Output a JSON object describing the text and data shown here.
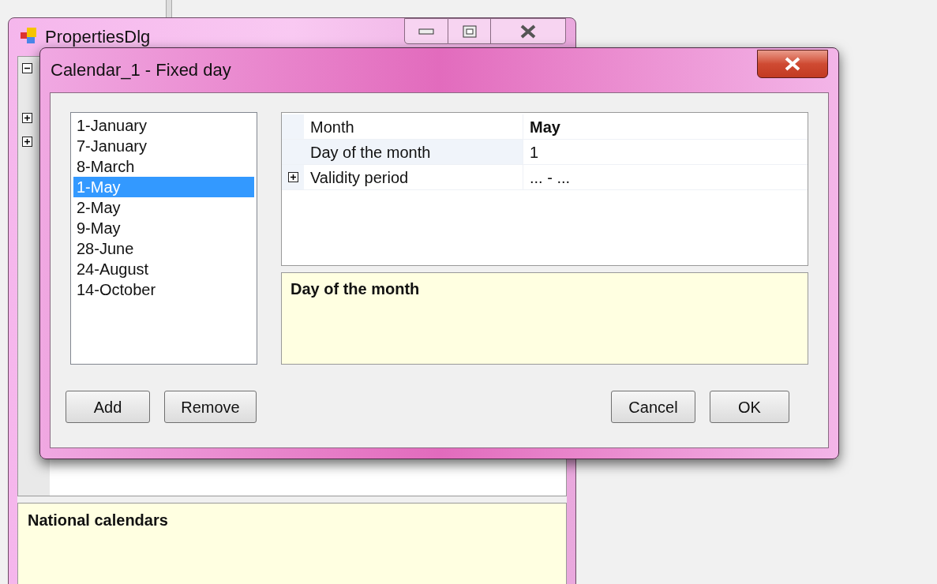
{
  "background_window": {
    "title": "PropertiesDlg",
    "tree": [
      {
        "expanded": true
      },
      {
        "expanded": false
      },
      {
        "expanded": false
      }
    ],
    "description": {
      "title": "National calendars"
    }
  },
  "dialog": {
    "title": "Calendar_1 - Fixed day",
    "list": [
      {
        "label": "1-January",
        "selected": false
      },
      {
        "label": "7-January",
        "selected": false
      },
      {
        "label": "8-March",
        "selected": false
      },
      {
        "label": "1-May",
        "selected": true
      },
      {
        "label": "2-May",
        "selected": false
      },
      {
        "label": "9-May",
        "selected": false
      },
      {
        "label": "28-June",
        "selected": false
      },
      {
        "label": "24-August",
        "selected": false
      },
      {
        "label": "14-October",
        "selected": false
      }
    ],
    "properties": [
      {
        "label": "Month",
        "value": "May",
        "modified": true,
        "selected": false
      },
      {
        "label": "Day of the month",
        "value": "1",
        "modified": false,
        "selected": true
      },
      {
        "label": "Validity period",
        "value": "... - ...",
        "modified": false,
        "selected": false,
        "expanded": false
      }
    ],
    "description": {
      "title": "Day of the month"
    },
    "buttons_left": [
      "Add",
      "Remove"
    ],
    "buttons_right": [
      "Cancel",
      "OK"
    ]
  }
}
